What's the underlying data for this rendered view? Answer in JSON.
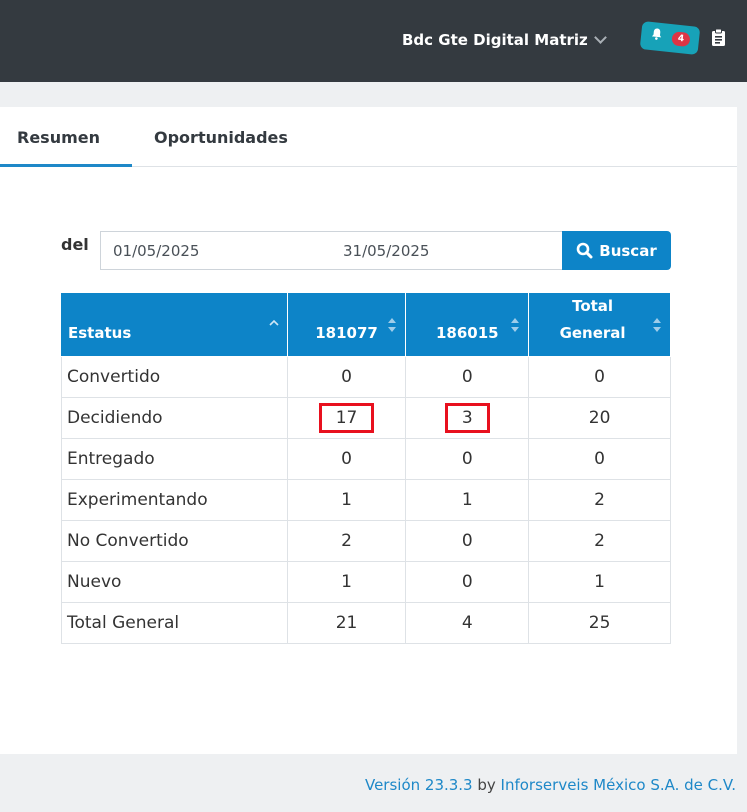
{
  "header": {
    "user_name": "Bdc Gte Digital Matriz",
    "notifications_count": "4"
  },
  "tabs": [
    {
      "label": "Resumen",
      "active": true
    },
    {
      "label": "Oportunidades",
      "active": false
    }
  ],
  "filter": {
    "label": "del",
    "date_from": "01/05/2025",
    "date_to": "31/05/2025",
    "search_label": "Buscar"
  },
  "table": {
    "headers": [
      "Estatus",
      "181077",
      "186015",
      "Total General"
    ],
    "rows": [
      [
        "Convertido",
        "0",
        "0",
        "0"
      ],
      [
        "Decidiendo",
        "17",
        "3",
        "20"
      ],
      [
        "Entregado",
        "0",
        "0",
        "0"
      ],
      [
        "Experimentando",
        "1",
        "1",
        "2"
      ],
      [
        "No Convertido",
        "2",
        "0",
        "2"
      ],
      [
        "Nuevo",
        "1",
        "0",
        "1"
      ],
      [
        "Total General",
        "21",
        "4",
        "25"
      ]
    ]
  },
  "footer": {
    "version": "Versión 23.3.3",
    "by": " by ",
    "company": "Inforserveis México S.A. de C.V."
  },
  "colors": {
    "topbar": "#343a40",
    "primary": "#0d84c8",
    "badge": "#dc3545",
    "highlight": "#e8101e"
  }
}
